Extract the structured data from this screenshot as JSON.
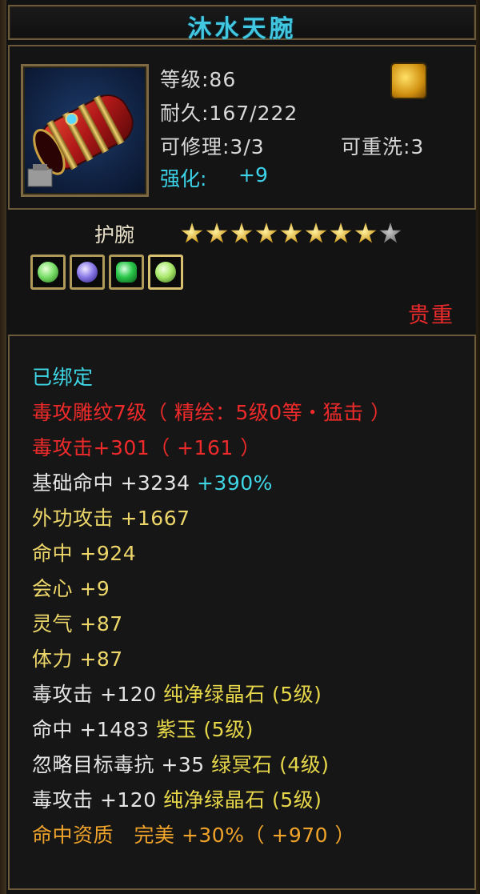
{
  "item": {
    "name": "沐水天腕",
    "level_label": "等级:86",
    "durability_label": "耐久:167/222",
    "repair_label": "可修理:3/3",
    "rewash_label": "可重洗:3",
    "enhance_key": "强化:",
    "enhance_value": "+9",
    "type": "护腕",
    "rarity": "贵重",
    "stars_filled": 8,
    "stars_total": 9,
    "gems": [
      {
        "icon": "green-gem-icon",
        "color": "#7adf6a"
      },
      {
        "icon": "purple-gem-icon",
        "color": "#8a7ae8"
      },
      {
        "icon": "emerald-gem-icon",
        "color": "#2ac84a"
      },
      {
        "icon": "green-gem-icon",
        "color": "#a8e86a"
      }
    ]
  },
  "attributes": [
    {
      "text": "已绑定",
      "color": "cyan"
    },
    {
      "text": "毒攻雕纹7级（ 精绘：5级0等・猛击 ）",
      "color": "red"
    },
    {
      "text": "毒攻击+301（ +161 ）",
      "color": "red"
    },
    {
      "text": "基础命中 +3234",
      "color": "white",
      "extra": "+390%",
      "extra_color": "cyan"
    },
    {
      "text": "外功攻击 +1667",
      "color": "yellow"
    },
    {
      "text": "命中 +924",
      "color": "yellow"
    },
    {
      "text": "会心 +9",
      "color": "yellow"
    },
    {
      "text": "灵气 +87",
      "color": "yellow"
    },
    {
      "text": "体力 +87",
      "color": "yellow"
    },
    {
      "text": "毒攻击 +120",
      "color": "white",
      "extra": "纯净绿晶石 (5级)",
      "extra_color": "green"
    },
    {
      "text": "命中 +1483",
      "color": "white",
      "extra": "紫玉 (5级)",
      "extra_color": "green"
    },
    {
      "text": "忽略目标毒抗 +35",
      "color": "white",
      "extra": "绿冥石 (4级)",
      "extra_color": "green"
    },
    {
      "text": "毒攻击 +120",
      "color": "white",
      "extra": "纯净绿晶石 (5级)",
      "extra_color": "green"
    },
    {
      "text": "命中资质　完美 +30%（ +970 ）",
      "color": "orange"
    }
  ]
}
